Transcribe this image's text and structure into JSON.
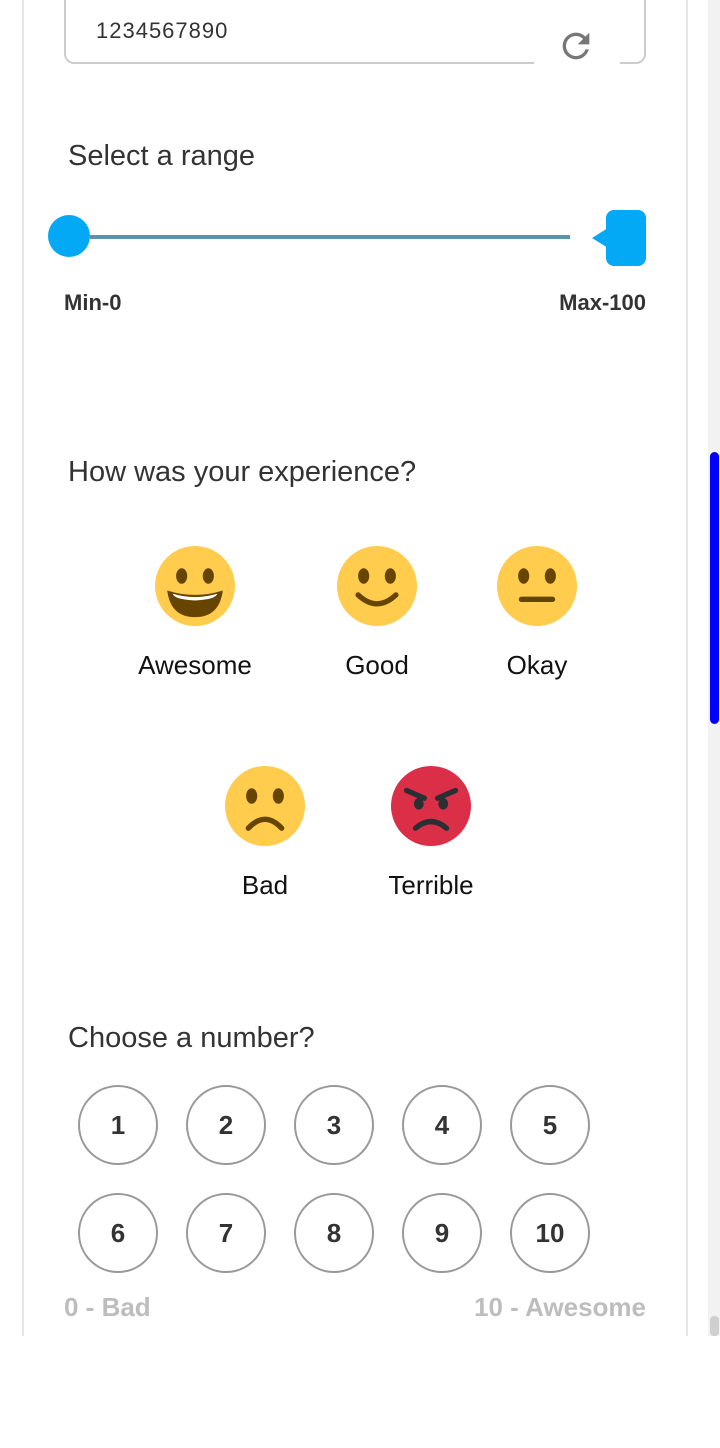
{
  "code_field": {
    "value": "1234567890"
  },
  "icons": {
    "refresh": "refresh-icon"
  },
  "range": {
    "title": "Select a range",
    "min_label": "Min-0",
    "max_label": "Max-100",
    "min_value": 0,
    "max_value": 100
  },
  "experience": {
    "title": "How was your experience?",
    "options": [
      {
        "label": "Awesome",
        "icon": "grinning-face-icon"
      },
      {
        "label": "Good",
        "icon": "smiling-face-icon"
      },
      {
        "label": "Okay",
        "icon": "neutral-face-icon"
      },
      {
        "label": "Bad",
        "icon": "frowning-face-icon"
      },
      {
        "label": "Terrible",
        "icon": "angry-face-icon"
      }
    ]
  },
  "number": {
    "title": "Choose a number?",
    "options": [
      "1",
      "2",
      "3",
      "4",
      "5",
      "6",
      "7",
      "8",
      "9",
      "10"
    ],
    "low_label": "0 - Bad",
    "high_label": "10 - Awesome"
  },
  "colors": {
    "accent": "#03a9f4",
    "emoji_yellow": "#FFCC4D",
    "emoji_red": "#DA2F47",
    "scrollbar": "#0000ff"
  }
}
